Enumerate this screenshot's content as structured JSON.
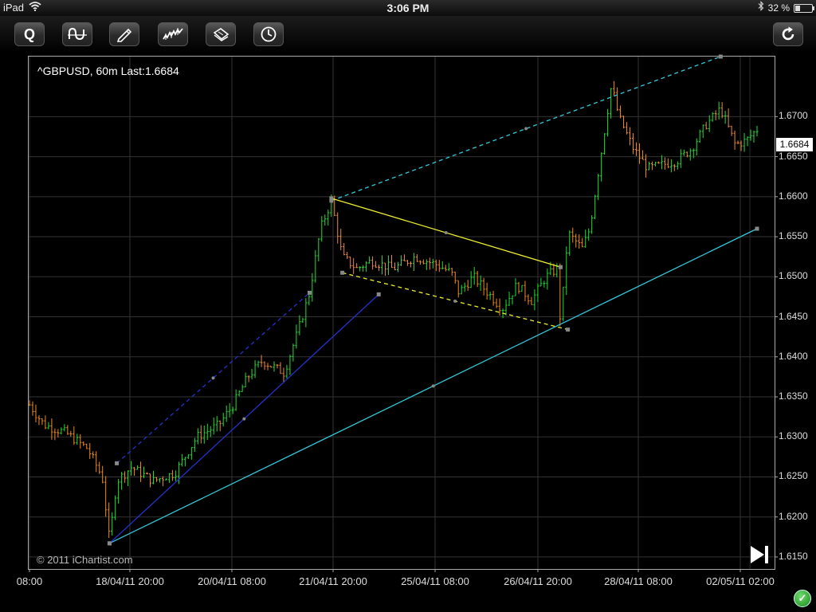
{
  "status_bar": {
    "device": "iPad",
    "time": "3:06 PM",
    "battery": "32 %",
    "battery_level": 0.32,
    "icons": [
      "wifi-icon",
      "bluetooth-icon",
      "battery-icon"
    ]
  },
  "toolbar": {
    "buttons": [
      {
        "name": "quote",
        "label": "Q",
        "icon": "quote-icon"
      },
      {
        "name": "indicators",
        "icon": "indicator-wave-icon"
      },
      {
        "name": "draw",
        "icon": "pencil-icon"
      },
      {
        "name": "chart-style",
        "icon": "price-chart-icon"
      },
      {
        "name": "notes",
        "icon": "note-pad-icon"
      },
      {
        "name": "timeframe",
        "icon": "clock-icon"
      },
      {
        "name": "refresh",
        "icon": "refresh-icon"
      }
    ]
  },
  "chart": {
    "title": "^GBPUSD, 60m Last:1.6684",
    "last_value": "1.6684",
    "copyright": "© 2011 iChartist.com",
    "play_icon": "play-end-icon",
    "ok_icon": "check-circle-icon"
  },
  "chart_data": {
    "type": "candlestick",
    "symbol": "^GBPUSD",
    "interval": "60m",
    "last": 1.6684,
    "ylim": [
      1.6135,
      1.6775
    ],
    "yticks": [
      "1.6700",
      "1.6650",
      "1.6600",
      "1.6550",
      "1.6500",
      "1.6450",
      "1.6400",
      "1.6350",
      "1.6300",
      "1.6250",
      "1.6200",
      "1.6150"
    ],
    "xticks": [
      "08:00",
      "18/04/11 20:00",
      "20/04/11 08:00",
      "21/04/11 20:00",
      "25/04/11 08:00",
      "26/04/11 20:00",
      "28/04/11 08:00",
      "02/05/11 02:00"
    ],
    "grid": true,
    "colors": {
      "up": "#22dd33",
      "down": "#f08a28",
      "frame": "#aaaaaa",
      "grid": "#333333"
    },
    "price_path": [
      [
        0,
        1.634
      ],
      [
        0.02,
        1.6315
      ],
      [
        0.05,
        1.6305
      ],
      [
        0.08,
        1.6285
      ],
      [
        0.1,
        1.625
      ],
      [
        0.11,
        1.617
      ],
      [
        0.12,
        1.6245
      ],
      [
        0.14,
        1.6262
      ],
      [
        0.17,
        1.6245
      ],
      [
        0.2,
        1.6255
      ],
      [
        0.23,
        1.63
      ],
      [
        0.26,
        1.6315
      ],
      [
        0.28,
        1.634
      ],
      [
        0.3,
        1.6375
      ],
      [
        0.32,
        1.6395
      ],
      [
        0.35,
        1.638
      ],
      [
        0.37,
        1.6435
      ],
      [
        0.385,
        1.648
      ],
      [
        0.4,
        1.656
      ],
      [
        0.415,
        1.6595
      ],
      [
        0.43,
        1.6525
      ],
      [
        0.45,
        1.651
      ],
      [
        0.47,
        1.652
      ],
      [
        0.5,
        1.651
      ],
      [
        0.53,
        1.6525
      ],
      [
        0.56,
        1.6515
      ],
      [
        0.58,
        1.6505
      ],
      [
        0.59,
        1.648
      ],
      [
        0.61,
        1.65
      ],
      [
        0.63,
        1.648
      ],
      [
        0.65,
        1.646
      ],
      [
        0.67,
        1.649
      ],
      [
        0.69,
        1.647
      ],
      [
        0.71,
        1.65
      ],
      [
        0.725,
        1.651
      ],
      [
        0.73,
        1.644
      ],
      [
        0.74,
        1.6555
      ],
      [
        0.76,
        1.6535
      ],
      [
        0.77,
        1.656
      ],
      [
        0.78,
        1.662
      ],
      [
        0.79,
        1.668
      ],
      [
        0.8,
        1.674
      ],
      [
        0.81,
        1.67
      ],
      [
        0.83,
        1.666
      ],
      [
        0.85,
        1.6635
      ],
      [
        0.87,
        1.664
      ],
      [
        0.89,
        1.6645
      ],
      [
        0.91,
        1.666
      ],
      [
        0.93,
        1.669
      ],
      [
        0.95,
        1.671
      ],
      [
        0.97,
        1.6665
      ],
      [
        0.985,
        1.667
      ],
      [
        1.0,
        1.6684
      ]
    ],
    "trendlines": [
      {
        "color": "#33c6d6",
        "style": "solid",
        "from": [
          0.11,
          1.6167
        ],
        "to": [
          1.0,
          1.656
        ]
      },
      {
        "color": "#33c6d6",
        "style": "dashed",
        "from": [
          0.415,
          1.6595
        ],
        "to": [
          0.95,
          1.6775
        ]
      },
      {
        "color": "#eeee33",
        "style": "solid",
        "from": [
          0.415,
          1.6598
        ],
        "to": [
          0.73,
          1.6512
        ]
      },
      {
        "color": "#eeee33",
        "style": "dashed",
        "from": [
          0.43,
          1.6505
        ],
        "to": [
          0.74,
          1.6434
        ]
      },
      {
        "color": "#2233cc",
        "style": "solid",
        "from": [
          0.11,
          1.6167
        ],
        "to": [
          0.48,
          1.6478
        ]
      },
      {
        "color": "#2233cc",
        "style": "dashed",
        "from": [
          0.12,
          1.6267
        ],
        "to": [
          0.385,
          1.648
        ]
      }
    ]
  }
}
